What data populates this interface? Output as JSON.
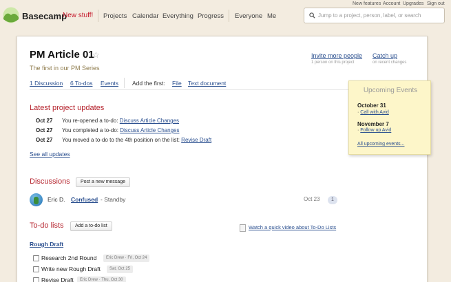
{
  "header": {
    "brand": "Basecamp",
    "new_stuff": "New stuff!",
    "nav": [
      "Projects",
      "Calendar",
      "Everything",
      "Progress",
      "Everyone",
      "Me"
    ],
    "top_links": [
      "New features",
      "Account",
      "Upgrades",
      "Sign out"
    ],
    "search_placeholder": "Jump to a project, person, label, or search"
  },
  "project": {
    "title": "PM Article 01",
    "subtitle": "The first in our PM Series",
    "invite_label": "Invite more people",
    "invite_sub": "1 person on this project",
    "catch_label": "Catch up",
    "catch_sub": "on recent changes"
  },
  "tabs": {
    "discussion": "1 Discussion",
    "todos": "6 To-dos",
    "events": "Events",
    "add_first": "Add the first:",
    "file": "File",
    "text_document": "Text document"
  },
  "updates": {
    "heading": "Latest project updates",
    "items": [
      {
        "date": "Oct 27",
        "text": "You re-opened a to-do:",
        "link": "Discuss Article Changes"
      },
      {
        "date": "Oct 27",
        "text": "You completed a to-do:",
        "link": "Discuss Article Changes"
      },
      {
        "date": "Oct 27",
        "text": "You moved a to-do to the 4th position on the list:",
        "link": "Revise Draft"
      }
    ],
    "see_all": "See all updates"
  },
  "events": {
    "title": "Upcoming Events",
    "items": [
      {
        "date": "October 31",
        "event": "Call with Avid"
      },
      {
        "date": "November 7",
        "event": "Follow up Avid"
      }
    ],
    "all_link": "All upcoming events..."
  },
  "discussions": {
    "heading": "Discussions",
    "button": "Post a new message",
    "row": {
      "author": "Eric D.",
      "title": "Confused",
      "excerpt": "- Standby",
      "date": "Oct 23",
      "count": "1"
    }
  },
  "todolists": {
    "heading": "To-do lists",
    "button": "Add a to-do list",
    "video_link": "Watch a quick video about To-Do Lists",
    "list_title": "Rough Draft",
    "items": [
      {
        "text": "Research 2nd Round",
        "meta": "Eric Drew · Fri, Oct 24"
      },
      {
        "text": "Write new Rough Draft",
        "meta": "Sat, Oct 25"
      },
      {
        "text": "Revise Draft",
        "meta": "Eric Drew · Thu, Oct 30"
      }
    ]
  }
}
